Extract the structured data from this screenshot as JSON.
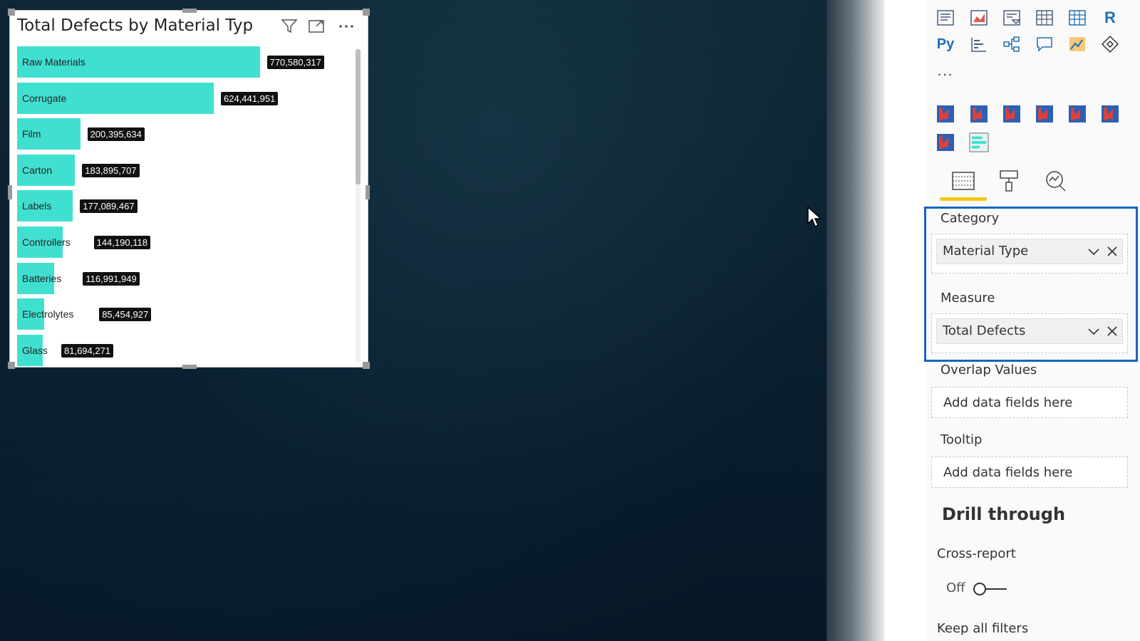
{
  "visual": {
    "title": "Total Defects by Material Typ",
    "icons": [
      "filter-icon",
      "focus-mode-icon",
      "more-options-icon"
    ],
    "bar_color": "#40e0d0"
  },
  "chart_data": {
    "type": "bar",
    "orientation": "horizontal",
    "title": "Total Defects by Material Typ",
    "categories": [
      "Raw Materials",
      "Corrugate",
      "Film",
      "Carton",
      "Labels",
      "Controllers",
      "Batteries",
      "Electrolytes",
      "Glass"
    ],
    "values": [
      770580317,
      624441951,
      200395634,
      183895707,
      177089467,
      144190118,
      116991949,
      85454927,
      81694271
    ],
    "value_labels": [
      "770,580,317",
      "624,441,951",
      "200,395,634",
      "183,895,707",
      "177,089,467",
      "144,190,118",
      "116,991,949",
      "85,454,927",
      "81,694,271"
    ],
    "xlim": [
      0,
      1000000000
    ],
    "grid": false,
    "legend": "none"
  },
  "panel": {
    "viz_icons_row1": [
      "table-report-icon",
      "area-chart-icon",
      "slicer-icon",
      "table-icon",
      "matrix-icon",
      "r-visual-icon"
    ],
    "viz_icons_row2": [
      "python-visual-icon",
      "key-influencers-icon",
      "decomposition-tree-icon",
      "qa-icon",
      "arcgis-map-icon",
      "power-apps-icon"
    ],
    "more_label": "...",
    "custom_icons": [
      "custom-visual-icon",
      "custom-visual-icon",
      "custom-visual-icon",
      "custom-visual-icon",
      "custom-visual-icon",
      "custom-visual-icon",
      "custom-visual-icon",
      "bar-chart-custom-icon"
    ],
    "tabs": [
      "fields-tab-icon",
      "format-tab-icon",
      "analytics-tab-icon"
    ],
    "category_label": "Category",
    "category_field": "Material Type",
    "measure_label": "Measure",
    "measure_field": "Total Defects",
    "overlap_label": "Overlap Values",
    "overlap_placeholder": "Add data fields here",
    "tooltip_label": "Tooltip",
    "tooltip_placeholder": "Add data fields here",
    "drill_title": "Drill through",
    "cross_report_label": "Cross-report",
    "toggle_state": "Off",
    "keep_filters_label": "Keep all filters",
    "accent_color": "#1565c0",
    "tab_highlight_color": "#f2c811"
  }
}
